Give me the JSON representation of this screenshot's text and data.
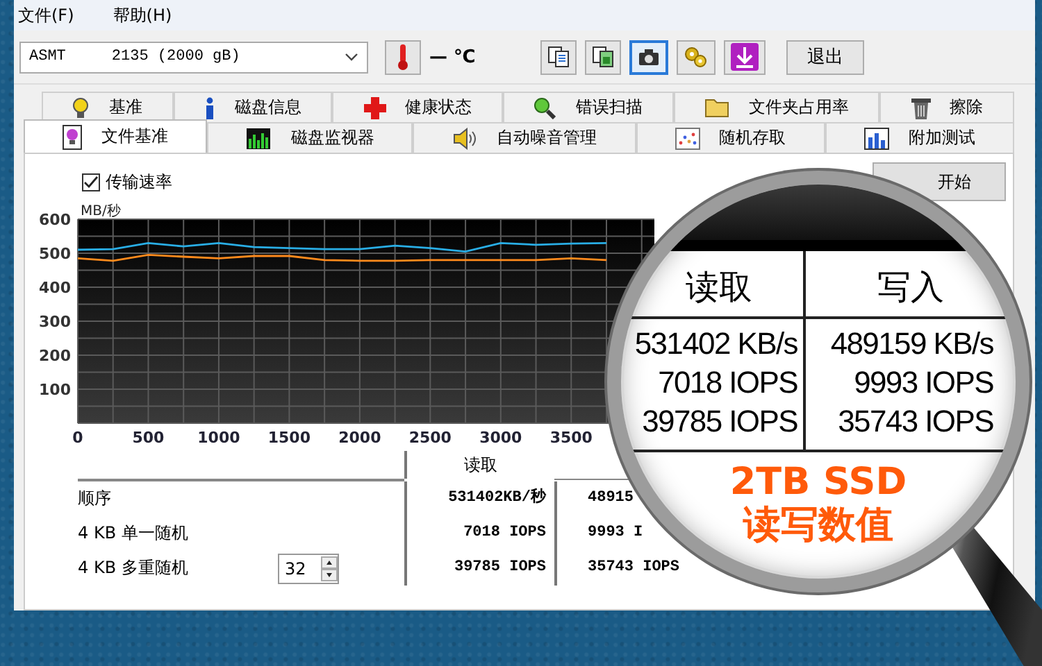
{
  "menu": [
    {
      "label": "文件(F)"
    },
    {
      "label": "帮助(H)"
    }
  ],
  "toolbar": {
    "drive": "ASMT     2135 (2000 gB)",
    "temperature": "— ℃",
    "buttons": [
      {
        "kind": "copy",
        "selected": false
      },
      {
        "kind": "copy-screen",
        "selected": false
      },
      {
        "kind": "camera",
        "selected": true
      },
      {
        "kind": "settings",
        "selected": false
      },
      {
        "kind": "save",
        "selected": false
      }
    ],
    "exit": "退出"
  },
  "tab_rows": [
    {
      "tabs": [
        {
          "label": "基准",
          "kind": "bulb",
          "selected": false
        },
        {
          "label": "磁盘信息",
          "kind": "info",
          "selected": false
        },
        {
          "label": "健康状态",
          "kind": "cross",
          "selected": false
        },
        {
          "label": "错误扫描",
          "kind": "magnifier",
          "selected": false
        },
        {
          "label": "文件夹占用率",
          "kind": "folder",
          "selected": false
        },
        {
          "label": "擦除",
          "kind": "trash",
          "selected": false
        }
      ]
    },
    {
      "tabs": [
        {
          "label": "文件基准",
          "kind": "file",
          "selected": true
        },
        {
          "label": "磁盘监视器",
          "kind": "bars",
          "selected": false
        },
        {
          "label": "自动噪音管理",
          "kind": "speaker",
          "selected": false
        },
        {
          "label": "随机存取",
          "kind": "scatter",
          "selected": false
        },
        {
          "label": "附加测试",
          "kind": "bars-blue",
          "selected": false
        }
      ]
    }
  ],
  "options": {
    "transfer_rate": {
      "label": "传输速率",
      "checked": true
    }
  },
  "start_button": "开始",
  "chart_data": {
    "type": "line",
    "ylabel": "MB/秒",
    "x": [
      0,
      250,
      500,
      750,
      1000,
      1250,
      1500,
      1750,
      2000,
      2250,
      2500,
      2750,
      3000,
      3250,
      3500,
      3750
    ],
    "series": [
      {
        "color": "#29aee6",
        "values": [
          510,
          512,
          530,
          520,
          530,
          518,
          515,
          512,
          512,
          522,
          515,
          505,
          530,
          525,
          528,
          530
        ]
      },
      {
        "color": "#ff8a1c",
        "values": [
          485,
          478,
          495,
          490,
          485,
          492,
          492,
          480,
          478,
          478,
          480,
          480,
          480,
          480,
          485,
          480
        ]
      }
    ],
    "grid": true,
    "xlim": [
      0,
      4090
    ],
    "ylim": [
      0,
      600
    ],
    "xticks": [
      0,
      500,
      1000,
      1500,
      2000,
      2500,
      3000,
      3500
    ],
    "yticks": [
      100,
      200,
      300,
      400,
      500,
      600
    ]
  },
  "results": {
    "columns": [
      "读取"
    ],
    "rows": [
      {
        "kind": "plain",
        "label": "顺序",
        "read": "531402KB/秒",
        "write": "48915"
      },
      {
        "kind": "plain",
        "label": "4 KB 单一随机",
        "read": "7018 IOPS",
        "write": "9993 I"
      },
      {
        "kind": "queue",
        "label": "4 KB 多重随机",
        "queue_depth": "32",
        "read": "39785 IOPS",
        "write": "35743 IOPS"
      }
    ]
  },
  "magnifier": {
    "columns": [
      "读取",
      "写入"
    ],
    "rows": [
      {
        "read": "531402 KB/s",
        "write": "489159 KB/s"
      },
      {
        "read": "7018 IOPS",
        "write": "9993 IOPS"
      },
      {
        "read": "39785 IOPS",
        "write": "35743 IOPS"
      }
    ],
    "caption": [
      "2TB SSD",
      "读写数值"
    ]
  }
}
